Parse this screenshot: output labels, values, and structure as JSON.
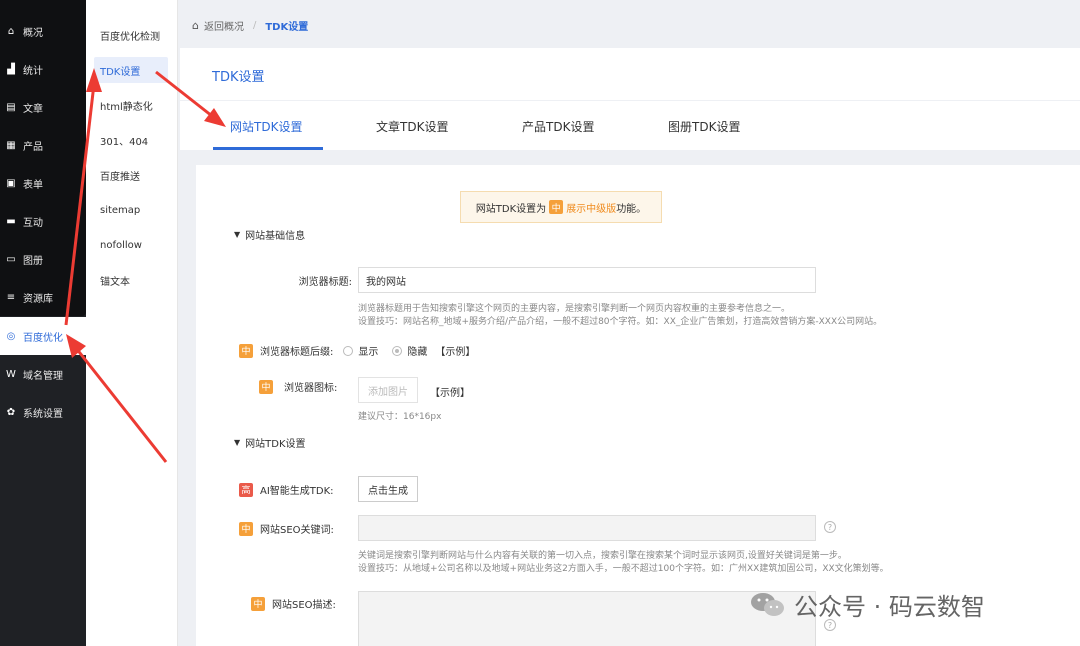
{
  "sidebar": {
    "items": [
      {
        "label": "概况",
        "icon": "home-icon",
        "glyph": "⌂"
      },
      {
        "label": "统计",
        "icon": "chart-icon",
        "glyph": "▟"
      },
      {
        "label": "文章",
        "icon": "article-icon",
        "glyph": "▤"
      },
      {
        "label": "产品",
        "icon": "product-icon",
        "glyph": "▦"
      },
      {
        "label": "表单",
        "icon": "form-icon",
        "glyph": "▣"
      },
      {
        "label": "互动",
        "icon": "chat-icon",
        "glyph": "▬"
      },
      {
        "label": "图册",
        "icon": "album-icon",
        "glyph": "▭"
      },
      {
        "label": "资源库",
        "icon": "database-icon",
        "glyph": "≡"
      },
      {
        "label": "百度优化",
        "icon": "seo-icon",
        "glyph": "◎"
      },
      {
        "label": "域名管理",
        "icon": "domain-icon",
        "glyph": "W"
      },
      {
        "label": "系统设置",
        "icon": "gear-icon",
        "glyph": "✿"
      }
    ]
  },
  "subnav": {
    "items": [
      {
        "label": "百度优化检测"
      },
      {
        "label": "TDK设置"
      },
      {
        "label": "html静态化"
      },
      {
        "label": "301、404"
      },
      {
        "label": "百度推送"
      },
      {
        "label": "sitemap"
      },
      {
        "label": "nofollow"
      },
      {
        "label": "锚文本"
      }
    ]
  },
  "breadcrumb": {
    "back": "返回概况",
    "sep": "/",
    "current": "TDK设置"
  },
  "header": {
    "title": "TDK设置"
  },
  "tabs": [
    {
      "label": "网站TDK设置"
    },
    {
      "label": "文章TDK设置"
    },
    {
      "label": "产品TDK设置"
    },
    {
      "label": "图册TDK设置"
    }
  ],
  "notice": {
    "prefix": "网站TDK设置为",
    "badge": "中",
    "edition": "展示中级版",
    "suffix": "功能。"
  },
  "section1": {
    "title": "网站基础信息"
  },
  "browser_title": {
    "label": "浏览器标题:",
    "value": "我的网站",
    "hint1": "浏览器标题用于告知搜索引擎这个网页的主要内容，是搜索引擎判断一个网页内容权重的主要参考信息之一。",
    "hint2": "设置技巧：网站名称_地域+服务介绍/产品介绍，一般不超过80个字符。如：XX_企业广告策划，打造高效营销方案-XXX公司网站。"
  },
  "title_suffix": {
    "badge": "中",
    "label": "浏览器标题后缀:",
    "opt_show": "显示",
    "opt_hide": "隐藏",
    "example": "【示例】"
  },
  "favicon": {
    "badge": "中",
    "label": "浏览器图标:",
    "button": "添加图片",
    "example": "【示例】",
    "hint": "建议尺寸：16*16px"
  },
  "section2": {
    "title": "网站TDK设置"
  },
  "ai_gen": {
    "badge": "高",
    "label": "AI智能生成TDK:",
    "button": "点击生成"
  },
  "seo_keywords": {
    "badge": "中",
    "label": "网站SEO关键词:",
    "value": "",
    "hint1": "关键词是搜索引擎判断网站与什么内容有关联的第一切入点，搜索引擎在搜索某个词时显示该网页,设置好关键词是第一步。",
    "hint2": "设置技巧：从地域+公司名称以及地域+网站业务这2方面入手，一般不超过100个字符。如：广州XX建筑加固公司，XX文化策划等。"
  },
  "seo_desc": {
    "badge": "中",
    "label": "网站SEO描述:"
  },
  "help": "?",
  "watermark": {
    "text": "公众号 · 码云数智"
  },
  "colors": {
    "accent": "#2f6bd8",
    "badge": "#f5a03a",
    "arrow": "#ec3b33"
  }
}
